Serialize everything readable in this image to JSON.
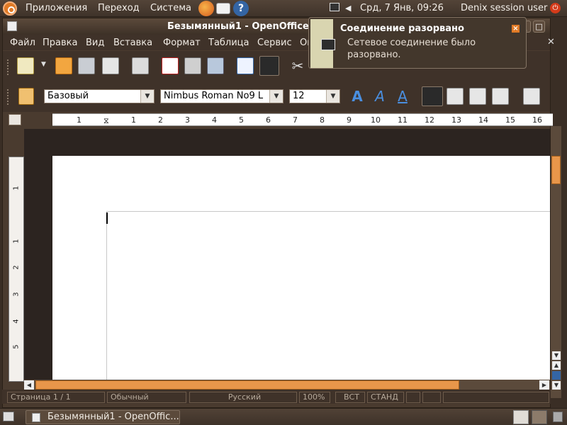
{
  "panel": {
    "menus": [
      "Приложения",
      "Переход",
      "Система"
    ],
    "clock": "Срд,  7 Янв, 09:26",
    "user": "Denix session user"
  },
  "window": {
    "title": "Безымянный1 - OpenOffice",
    "menu": [
      "Файл",
      "Правка",
      "Вид",
      "Вставка",
      "Формат",
      "Таблица",
      "Сервис",
      "Ок"
    ]
  },
  "format_toolbar": {
    "style": "Базовый",
    "font": "Nimbus Roman No9 L",
    "size": "12"
  },
  "ruler": {
    "h_numbers": [
      "1",
      "1",
      "2",
      "3",
      "4",
      "5",
      "6",
      "7",
      "8",
      "9",
      "10",
      "11",
      "12",
      "13",
      "14",
      "15",
      "16"
    ],
    "v_numbers": [
      "1",
      "1",
      "2",
      "3",
      "4",
      "5"
    ]
  },
  "notification": {
    "title": "Соединение разорвано",
    "body": "Сетевое соединение было разорвано."
  },
  "status": {
    "page": "Страница  1 / 1",
    "style": "Обычный",
    "language": "Русский",
    "zoom": "100%",
    "insert": "ВСТ",
    "std": "СТАНД"
  },
  "taskbar": {
    "item": "Безымянный1 - OpenOffic..."
  }
}
